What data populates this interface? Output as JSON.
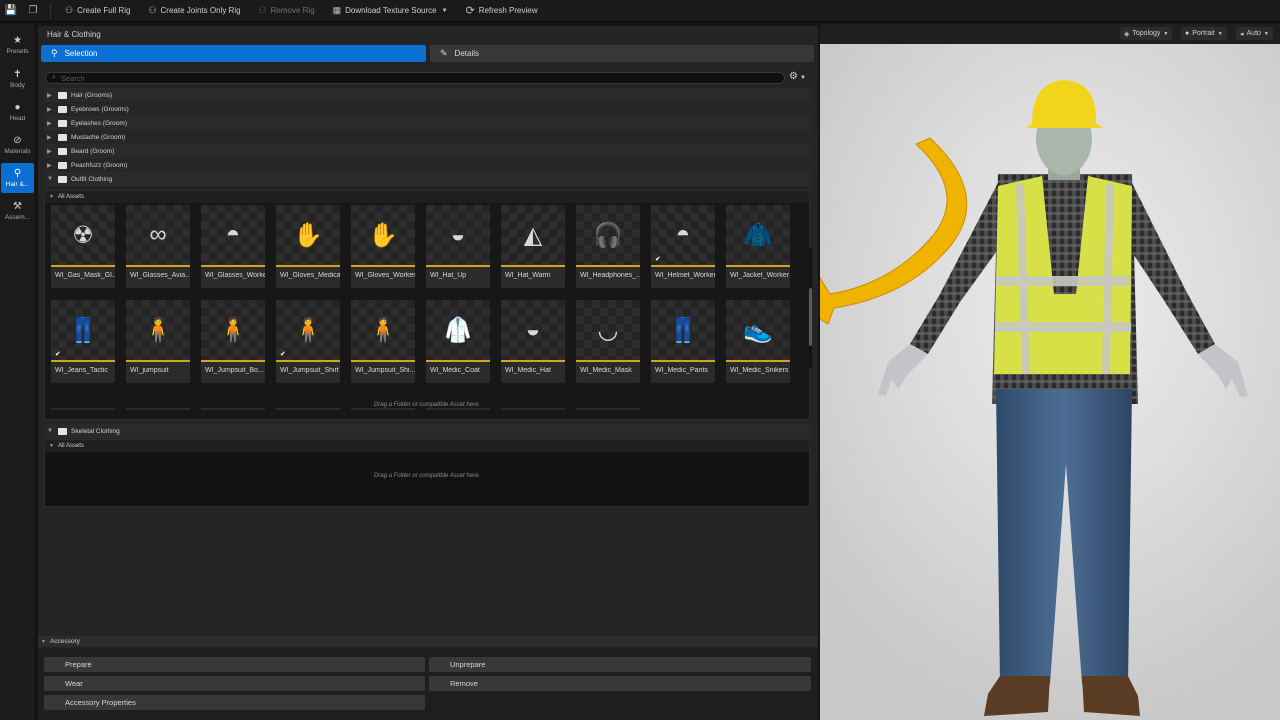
{
  "toolbar": {
    "create_full_rig": "Create Full Rig",
    "create_joints_only_rig": "Create Joints Only Rig",
    "remove_rig": "Remove Rig",
    "download_texture_source": "Download Texture Source",
    "refresh_preview": "Refresh Preview"
  },
  "sidenav": {
    "items": [
      {
        "label": "Presets",
        "icon": "star-icon"
      },
      {
        "label": "Body",
        "icon": "body-icon"
      },
      {
        "label": "Head",
        "icon": "head-icon"
      },
      {
        "label": "Materials",
        "icon": "materials-icon"
      },
      {
        "label": "Hair &...",
        "icon": "hair-clothing-icon",
        "active": true
      },
      {
        "label": "Assem...",
        "icon": "hammer-icon"
      }
    ]
  },
  "panel": {
    "title": "Hair & Clothing",
    "tabs": {
      "selection": "Selection",
      "details": "Details"
    },
    "search_placeholder": "Search"
  },
  "tree": {
    "items": [
      "Hair (Grooms)",
      "Eyebrows (Grooms)",
      "Eyelashes (Groom)",
      "Mustache (Groom)",
      "Beard (Groom)",
      "Peachfuzz (Groom)",
      "Outfit Clothing"
    ]
  },
  "outfit": {
    "all_assets": "All Assets",
    "row1": [
      {
        "name": "WI_Gas_Mask_Gl...",
        "glyph": "☢"
      },
      {
        "name": "WI_Glasses_Avia...",
        "glyph": "∞"
      },
      {
        "name": "WI_Glasses_Worker",
        "glyph": "◓"
      },
      {
        "name": "WI_Gloves_Medical",
        "glyph": "✋"
      },
      {
        "name": "WI_Gloves_Worker",
        "glyph": "✋"
      },
      {
        "name": "WI_Hat_Up",
        "glyph": "◒"
      },
      {
        "name": "WI_Hat_Warm",
        "glyph": "◭"
      },
      {
        "name": "WI_Headphones_...",
        "glyph": "🎧"
      },
      {
        "name": "WI_Helmet_Worker",
        "glyph": "◓",
        "checked": true
      },
      {
        "name": "WI_Jacket_Worker",
        "glyph": "🧥"
      }
    ],
    "row2": [
      {
        "name": "WI_Jeans_Tactic",
        "glyph": "👖",
        "checked": true
      },
      {
        "name": "WI_jumpsuit",
        "glyph": "🧍"
      },
      {
        "name": "WI_Jumpsuit_Bo...",
        "glyph": "🧍"
      },
      {
        "name": "WI_Jumpsuit_Shirt",
        "glyph": "🧍",
        "checked": true
      },
      {
        "name": "WI_Jumpsuit_Shi...",
        "glyph": "🧍"
      },
      {
        "name": "WI_Medic_Coat",
        "glyph": "🥼"
      },
      {
        "name": "WI_Medic_Hat",
        "glyph": "◒"
      },
      {
        "name": "WI_Medic_Mask",
        "glyph": "◡"
      },
      {
        "name": "WI_Medic_Pants",
        "glyph": "👖"
      },
      {
        "name": "WI_Medic_Snikers",
        "glyph": "👟"
      }
    ],
    "drop_hint": "Drag a Folder or compatible Asset here."
  },
  "skeletal": {
    "title": "Skeletal Clothing",
    "all_assets": "All Assets",
    "drop_hint": "Drag a Folder or compatible Asset here."
  },
  "accessory": {
    "title": "Accessory",
    "prepare": "Prepare",
    "unprepare": "Unprepare",
    "wear": "Wear",
    "remove": "Remove",
    "properties": "Accessory Properties"
  },
  "viewport": {
    "topology": "Topology",
    "portrait": "Portrait",
    "auto": "Auto"
  },
  "colors": {
    "accent_blue": "#0a70d4",
    "asset_bar": "#d4a41c",
    "arrow": "#f0b400",
    "vest": "#d8e048"
  }
}
